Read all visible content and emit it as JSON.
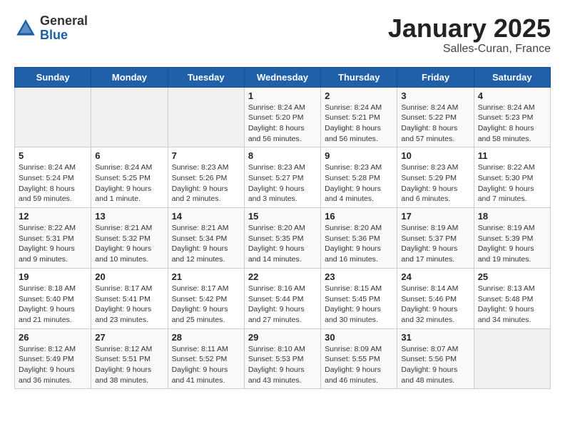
{
  "header": {
    "logo_general": "General",
    "logo_blue": "Blue",
    "title": "January 2025",
    "subtitle": "Salles-Curan, France"
  },
  "weekdays": [
    "Sunday",
    "Monday",
    "Tuesday",
    "Wednesday",
    "Thursday",
    "Friday",
    "Saturday"
  ],
  "weeks": [
    [
      {
        "day": "",
        "info": ""
      },
      {
        "day": "",
        "info": ""
      },
      {
        "day": "",
        "info": ""
      },
      {
        "day": "1",
        "info": "Sunrise: 8:24 AM\nSunset: 5:20 PM\nDaylight: 8 hours\nand 56 minutes."
      },
      {
        "day": "2",
        "info": "Sunrise: 8:24 AM\nSunset: 5:21 PM\nDaylight: 8 hours\nand 56 minutes."
      },
      {
        "day": "3",
        "info": "Sunrise: 8:24 AM\nSunset: 5:22 PM\nDaylight: 8 hours\nand 57 minutes."
      },
      {
        "day": "4",
        "info": "Sunrise: 8:24 AM\nSunset: 5:23 PM\nDaylight: 8 hours\nand 58 minutes."
      }
    ],
    [
      {
        "day": "5",
        "info": "Sunrise: 8:24 AM\nSunset: 5:24 PM\nDaylight: 8 hours\nand 59 minutes."
      },
      {
        "day": "6",
        "info": "Sunrise: 8:24 AM\nSunset: 5:25 PM\nDaylight: 9 hours\nand 1 minute."
      },
      {
        "day": "7",
        "info": "Sunrise: 8:23 AM\nSunset: 5:26 PM\nDaylight: 9 hours\nand 2 minutes."
      },
      {
        "day": "8",
        "info": "Sunrise: 8:23 AM\nSunset: 5:27 PM\nDaylight: 9 hours\nand 3 minutes."
      },
      {
        "day": "9",
        "info": "Sunrise: 8:23 AM\nSunset: 5:28 PM\nDaylight: 9 hours\nand 4 minutes."
      },
      {
        "day": "10",
        "info": "Sunrise: 8:23 AM\nSunset: 5:29 PM\nDaylight: 9 hours\nand 6 minutes."
      },
      {
        "day": "11",
        "info": "Sunrise: 8:22 AM\nSunset: 5:30 PM\nDaylight: 9 hours\nand 7 minutes."
      }
    ],
    [
      {
        "day": "12",
        "info": "Sunrise: 8:22 AM\nSunset: 5:31 PM\nDaylight: 9 hours\nand 9 minutes."
      },
      {
        "day": "13",
        "info": "Sunrise: 8:21 AM\nSunset: 5:32 PM\nDaylight: 9 hours\nand 10 minutes."
      },
      {
        "day": "14",
        "info": "Sunrise: 8:21 AM\nSunset: 5:34 PM\nDaylight: 9 hours\nand 12 minutes."
      },
      {
        "day": "15",
        "info": "Sunrise: 8:20 AM\nSunset: 5:35 PM\nDaylight: 9 hours\nand 14 minutes."
      },
      {
        "day": "16",
        "info": "Sunrise: 8:20 AM\nSunset: 5:36 PM\nDaylight: 9 hours\nand 16 minutes."
      },
      {
        "day": "17",
        "info": "Sunrise: 8:19 AM\nSunset: 5:37 PM\nDaylight: 9 hours\nand 17 minutes."
      },
      {
        "day": "18",
        "info": "Sunrise: 8:19 AM\nSunset: 5:39 PM\nDaylight: 9 hours\nand 19 minutes."
      }
    ],
    [
      {
        "day": "19",
        "info": "Sunrise: 8:18 AM\nSunset: 5:40 PM\nDaylight: 9 hours\nand 21 minutes."
      },
      {
        "day": "20",
        "info": "Sunrise: 8:17 AM\nSunset: 5:41 PM\nDaylight: 9 hours\nand 23 minutes."
      },
      {
        "day": "21",
        "info": "Sunrise: 8:17 AM\nSunset: 5:42 PM\nDaylight: 9 hours\nand 25 minutes."
      },
      {
        "day": "22",
        "info": "Sunrise: 8:16 AM\nSunset: 5:44 PM\nDaylight: 9 hours\nand 27 minutes."
      },
      {
        "day": "23",
        "info": "Sunrise: 8:15 AM\nSunset: 5:45 PM\nDaylight: 9 hours\nand 30 minutes."
      },
      {
        "day": "24",
        "info": "Sunrise: 8:14 AM\nSunset: 5:46 PM\nDaylight: 9 hours\nand 32 minutes."
      },
      {
        "day": "25",
        "info": "Sunrise: 8:13 AM\nSunset: 5:48 PM\nDaylight: 9 hours\nand 34 minutes."
      }
    ],
    [
      {
        "day": "26",
        "info": "Sunrise: 8:12 AM\nSunset: 5:49 PM\nDaylight: 9 hours\nand 36 minutes."
      },
      {
        "day": "27",
        "info": "Sunrise: 8:12 AM\nSunset: 5:51 PM\nDaylight: 9 hours\nand 38 minutes."
      },
      {
        "day": "28",
        "info": "Sunrise: 8:11 AM\nSunset: 5:52 PM\nDaylight: 9 hours\nand 41 minutes."
      },
      {
        "day": "29",
        "info": "Sunrise: 8:10 AM\nSunset: 5:53 PM\nDaylight: 9 hours\nand 43 minutes."
      },
      {
        "day": "30",
        "info": "Sunrise: 8:09 AM\nSunset: 5:55 PM\nDaylight: 9 hours\nand 46 minutes."
      },
      {
        "day": "31",
        "info": "Sunrise: 8:07 AM\nSunset: 5:56 PM\nDaylight: 9 hours\nand 48 minutes."
      },
      {
        "day": "",
        "info": ""
      }
    ]
  ]
}
